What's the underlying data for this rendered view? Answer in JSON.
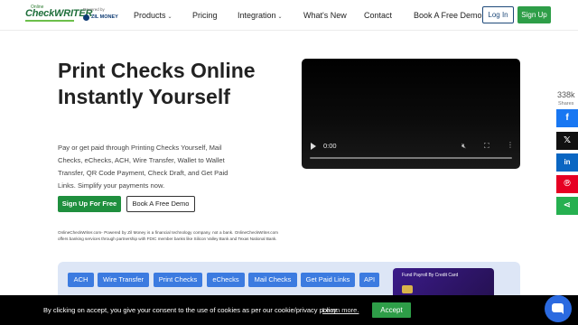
{
  "header": {
    "logo_top": "Online",
    "logo_text": "CheckWRITER",
    "powered_by": "Powered by",
    "zil_money": "ZIL MONEY",
    "nav": [
      {
        "label": "Products",
        "caret": true
      },
      {
        "label": "Pricing",
        "caret": false
      },
      {
        "label": "Integration",
        "caret": true
      },
      {
        "label": "What's New",
        "caret": false
      },
      {
        "label": "Contact",
        "caret": false
      },
      {
        "label": "Book A Free Demo",
        "caret": false
      }
    ],
    "login_label": "Log In",
    "signup_label": "Sign Up"
  },
  "hero": {
    "title": "Print Checks Online Instantly Yourself",
    "description": "Pay or get paid through Printing Checks Yourself, Mail Checks, eChecks, ACH, Wire Transfer, Wallet to Wallet Transfer, QR Code Payment, Check Draft, and Get Paid Links. Simplify your payments now.",
    "primary_button": "Sign Up For Free",
    "secondary_button": "Book A Free Demo",
    "disclaimer": "OnlineCheckWriter.com- Powered by Zil Money is a financial technology company, not a bank. OnlineCheckWriter.com offers banking services through partnership with FDIC member banks like Silicon Valley Bank and Texas National Bank."
  },
  "video": {
    "time": "0:00",
    "progress": 0
  },
  "share": {
    "count": "338k",
    "label": "Shares",
    "buttons": [
      {
        "icon": "facebook-icon",
        "glyph": "f"
      },
      {
        "icon": "x-icon",
        "glyph": "𝕏"
      },
      {
        "icon": "linkedin-icon",
        "glyph": "in"
      },
      {
        "icon": "pinterest-icon",
        "glyph": "℗"
      },
      {
        "icon": "share-icon",
        "glyph": "⋖"
      }
    ]
  },
  "features": {
    "tags": [
      "ACH",
      "Wire Transfer",
      "Print Checks",
      "eChecks",
      "Mail Checks",
      "Get Paid Links",
      "API"
    ],
    "card_title": "Fund Payroll By Credit Card"
  },
  "cookie": {
    "text": "By clicking on accept, you give your consent to the use of cookies as per our cookie/privacy policy.",
    "link": "Learn more.",
    "accept": "Accept"
  },
  "colors": {
    "brand_green": "#2e9e48",
    "accent_blue": "#3c7be0",
    "navy": "#1f4a7a"
  }
}
